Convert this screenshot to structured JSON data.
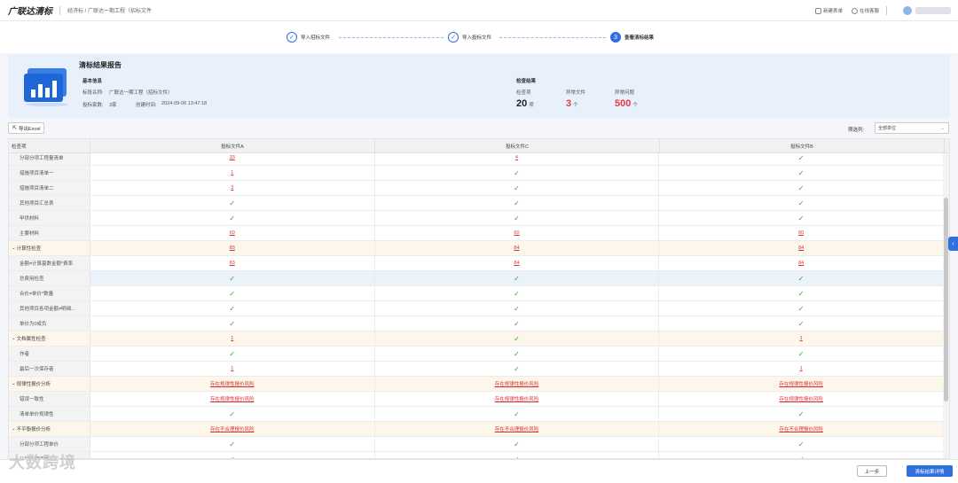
{
  "header": {
    "brand": "广联达清标",
    "breadcrumb": "经济标 / 广联达一期工程（招标文件",
    "help_label": "新建表单",
    "service_label": "在线客服"
  },
  "steps": [
    {
      "num": "✓",
      "label": "导入招标文件"
    },
    {
      "num": "✓",
      "label": "导入投标文件"
    },
    {
      "num": "3",
      "label": "查看清标结果"
    }
  ],
  "summary": {
    "title": "清标结果报告",
    "basic_info_label": "基本信息",
    "project_name_label": "标段名称:",
    "project_name": "广联达一期工程（招标文件）",
    "bidder_count_label": "投标家数:",
    "bidder_count": "3家",
    "created_label": "创建时间:",
    "created_time": "2024-09-06 13:47:18",
    "check_result_label": "检查结果",
    "items_label": "检查项",
    "items_value": "20",
    "items_unit": "项",
    "abnormal_files_label": "异常文件",
    "abnormal_files_value": "3",
    "abnormal_files_unit": "个",
    "abnormal_issues_label": "异常问题",
    "abnormal_issues_value": "500",
    "abnormal_issues_unit": "个"
  },
  "toolbar": {
    "export_label": "导出Excel",
    "filter_label": "筛选列:",
    "filter_value": "全部单位"
  },
  "table": {
    "columns": [
      "检查项",
      "投标文件A",
      "投标文件C",
      "投标文件B"
    ],
    "rows": [
      {
        "name": "分部分项工程量清单",
        "type": "item",
        "cells": [
          "33",
          "4",
          "✓"
        ]
      },
      {
        "name": "措施项目清单一",
        "type": "item",
        "cells": [
          "1",
          "✓",
          "✓"
        ]
      },
      {
        "name": "措施项目清单二",
        "type": "item",
        "cells": [
          "3",
          "✓",
          "✓"
        ]
      },
      {
        "name": "其他项目汇总表",
        "type": "item",
        "cells": [
          "✓",
          "✓",
          "✓"
        ]
      },
      {
        "name": "甲供材料",
        "type": "item",
        "cells": [
          "✓",
          "✓",
          "✓"
        ]
      },
      {
        "name": "主要材料",
        "type": "item",
        "cells": [
          "60",
          "60",
          "60"
        ]
      },
      {
        "name": "计算性检查",
        "type": "group",
        "cells": [
          "83",
          "84",
          "84"
        ]
      },
      {
        "name": "金额≠计算基数金额*费率",
        "type": "item",
        "cells": [
          "83",
          "84",
          "84"
        ]
      },
      {
        "name": "总费用检查",
        "type": "item",
        "hl": true,
        "cells": [
          "✓",
          "✓",
          "✓"
        ]
      },
      {
        "name": "合价≠单价*数量",
        "type": "item",
        "cells": [
          "✓",
          "✓",
          "✓"
        ]
      },
      {
        "name": "其他项目各项金额≠明细...",
        "type": "item",
        "cells": [
          "✓",
          "✓",
          "✓"
        ]
      },
      {
        "name": "单价为0或负",
        "type": "item",
        "cells": [
          "✓",
          "✓",
          "✓"
        ]
      },
      {
        "name": "文档属性检查",
        "type": "group",
        "cells": [
          "1",
          "✓",
          "1"
        ]
      },
      {
        "name": "作者",
        "type": "item",
        "cells": [
          "✓",
          "✓",
          "✓"
        ]
      },
      {
        "name": "最后一次保存者",
        "type": "item",
        "cells": [
          "1",
          "✓",
          "1"
        ]
      },
      {
        "name": "规律性报价分析",
        "type": "group",
        "cells": [
          "存在规律性报价风险",
          "存在规律性报价风险",
          "存在规律性报价风险"
        ]
      },
      {
        "name": "错误一致性",
        "type": "item",
        "cells": [
          "存在规律性报价风险",
          "存在规律性报价风险",
          "存在规律性报价风险"
        ]
      },
      {
        "name": "清单单价规律性",
        "type": "item",
        "cells": [
          "✓",
          "✓",
          "✓"
        ]
      },
      {
        "name": "不平衡报价分析",
        "type": "group",
        "cells": [
          "存在不合理报价风险",
          "存在不合理报价风险",
          "存在不合理报价风险"
        ]
      },
      {
        "name": "分部分项工程单价",
        "type": "item",
        "cells": [
          "✓",
          "✓",
          "✓"
        ]
      },
      {
        "name": "分部分项清单...",
        "type": "item",
        "cells": [
          "✓",
          "✓",
          "✓"
        ]
      }
    ]
  },
  "footer": {
    "prev_label": "上一步",
    "next_label": "清标结果详情"
  },
  "watermark": "大数跨境",
  "colors": {
    "accent": "#2f6fe0",
    "error": "#d92f2f",
    "ok": "#2ea043",
    "group_bg": "#fdf6ea"
  }
}
